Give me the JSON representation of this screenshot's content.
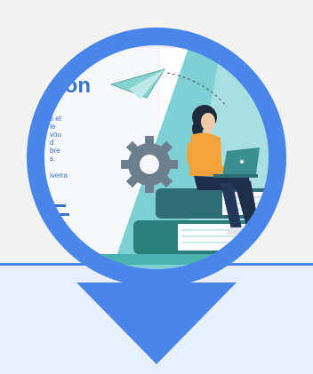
{
  "illustration": {
    "heading_fragment": "ion",
    "fragment_lines": [
      "s et",
      "le",
      "vou",
      "d",
      "bre",
      "s."
    ],
    "fragment_link": "iverra"
  },
  "colors": {
    "pin_blue": "#4a86ea",
    "panel_bg": "#e9f0fd",
    "teal": "#5fc3c6",
    "dark_teal": "#2f6f73",
    "page_bg": "#f3f3f3"
  },
  "icons": [
    "location-pin-icon",
    "paper-plane-icon",
    "gear-icon",
    "graduation-cap-icon",
    "laptop-icon",
    "books-icon"
  ]
}
